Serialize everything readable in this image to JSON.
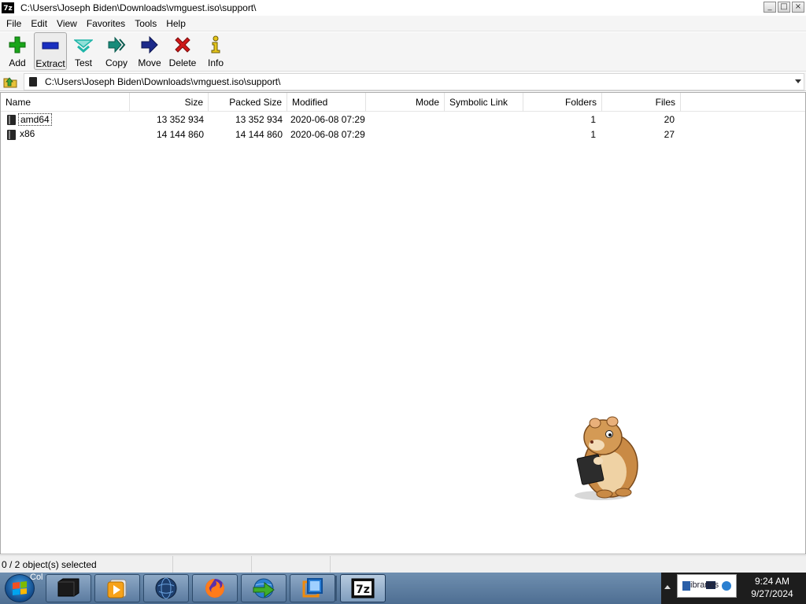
{
  "window": {
    "icon_label": "7z",
    "title": "C:\\Users\\Joseph Biden\\Downloads\\vmguest.iso\\support\\",
    "controls": {
      "minimize": "_",
      "maximize": "□",
      "close": "×"
    }
  },
  "menu": [
    "File",
    "Edit",
    "View",
    "Favorites",
    "Tools",
    "Help"
  ],
  "toolbar": [
    {
      "label": "Add",
      "icon": "plus-icon",
      "color": "#1aa51a"
    },
    {
      "label": "Extract",
      "icon": "minus-icon",
      "color": "#1a2fc0"
    },
    {
      "label": "Test",
      "icon": "check-chevron-icon",
      "color": "#1fb5a8"
    },
    {
      "label": "Copy",
      "icon": "double-arrow-icon",
      "color": "#178b7a"
    },
    {
      "label": "Move",
      "icon": "arrow-right-icon",
      "color": "#1c2a8a"
    },
    {
      "label": "Delete",
      "icon": "x-icon",
      "color": "#d01818"
    },
    {
      "label": "Info",
      "icon": "info-icon",
      "color": "#e6c61a"
    }
  ],
  "address": {
    "path": "C:\\Users\\Joseph Biden\\Downloads\\vmguest.iso\\support\\"
  },
  "columns": [
    "Name",
    "Size",
    "Packed Size",
    "Modified",
    "Mode",
    "Symbolic Link",
    "Folders",
    "Files"
  ],
  "rows": [
    {
      "name": "amd64",
      "size": "13 352 934",
      "packed": "13 352 934",
      "modified": "2020-06-08 07:29",
      "mode": "",
      "symlink": "",
      "folders": "1",
      "files": "20"
    },
    {
      "name": "x86",
      "size": "14 144 860",
      "packed": "14 144 860",
      "modified": "2020-06-08 07:29",
      "mode": "",
      "symlink": "",
      "folders": "1",
      "files": "27"
    }
  ],
  "status": {
    "selection": "0 / 2 object(s) selected",
    "seg2": "",
    "seg3": "",
    "seg4": ""
  },
  "taskbar": {
    "start_caption": "Col",
    "apps": [
      "terminal-app-icon",
      "media-player-icon",
      "globe-app-icon",
      "firefox-icon",
      "download-manager-icon",
      "virtualbox-icon",
      "7zip-app-icon"
    ],
    "tray_popup": "ibraries",
    "time": "9:24 AM",
    "date": "9/27/2024"
  }
}
